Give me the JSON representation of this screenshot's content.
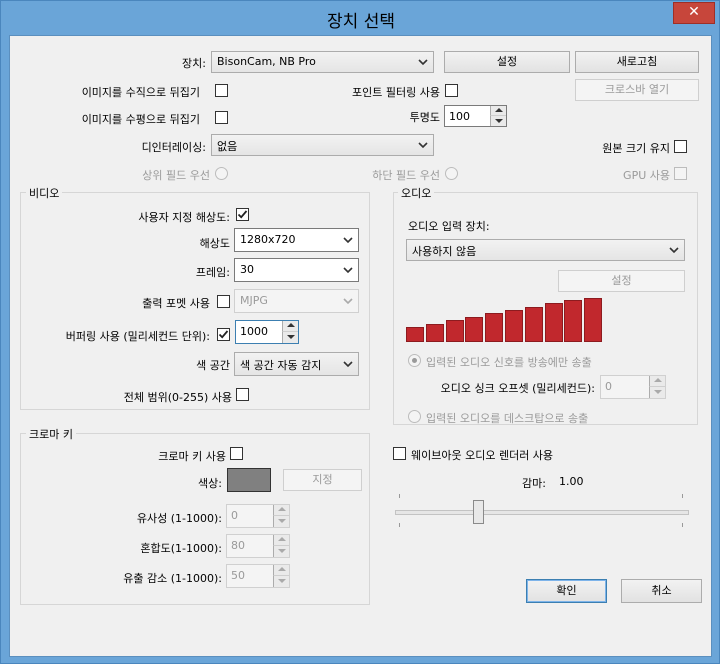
{
  "window": {
    "title": "장치 선택",
    "close": "✕"
  },
  "device": {
    "label": "장치:",
    "value": "BisonCam, NB Pro",
    "settings_btn": "설정",
    "refresh_btn": "새로고침",
    "crossbar_btn": "크로스바 열기"
  },
  "flip_v": "이미지를 수직으로 뒤집기",
  "flip_h": "이미지를 수평으로 뒤집기",
  "point_filter": "포인트 필터링 사용",
  "opacity": {
    "label": "투명도",
    "value": "100"
  },
  "deinterlace": {
    "label": "디인터레이싱:",
    "value": "없음"
  },
  "keep_size": "원본 크기 유지",
  "upper_field": "상위 필드 우선",
  "lower_field": "하단 필드 우선",
  "gpu": "GPU 사용",
  "video": {
    "title": "비디오",
    "custom_res": "사용자 지정 해상도:",
    "resolution": {
      "label": "해상도",
      "value": "1280x720"
    },
    "frame": {
      "label": "프레임:",
      "value": "30"
    },
    "output_format": {
      "label": "출력 포멧 사용",
      "value": "MJPG"
    },
    "buffering": {
      "label": "버퍼링 사용 (밀리세컨드 단위):",
      "value": "1000"
    },
    "color_space": {
      "label": "색 공간",
      "value": "색 공간 자동 감지"
    },
    "full_range": "전체 범위(0-255) 사용"
  },
  "audio": {
    "title": "오디오",
    "input_label": "오디오 입력 장치:",
    "input_value": "사용하지 않음",
    "settings_btn": "설정",
    "level_bars": [
      0.35,
      0.42,
      0.5,
      0.57,
      0.65,
      0.72,
      0.8,
      0.88,
      0.95,
      1.0
    ],
    "broadcast_only": "입력된 오디오 신호를 방송에만 송출",
    "sync_offset": {
      "label": "오디오 싱크 오프셋 (밀리세컨드):",
      "value": "0"
    },
    "desktop_out": "입력된 오디오를 데스크탑으로 송출"
  },
  "chroma": {
    "title": "크로마 키",
    "use": "크로마 키 사용",
    "color_label": "색상:",
    "color_value": "#808080",
    "assign_btn": "지정",
    "similarity": {
      "label": "유사성 (1-1000):",
      "value": "0"
    },
    "blend": {
      "label": "혼합도(1-1000):",
      "value": "80"
    },
    "spill": {
      "label": "유출 감소 (1-1000):",
      "value": "50"
    }
  },
  "wave_out": "웨이브아웃 오디오 렌더러 사용",
  "gamma": {
    "label": "감마:",
    "value": "1.00",
    "level": 0.28
  },
  "ok_btn": "확인",
  "cancel_btn": "취소"
}
